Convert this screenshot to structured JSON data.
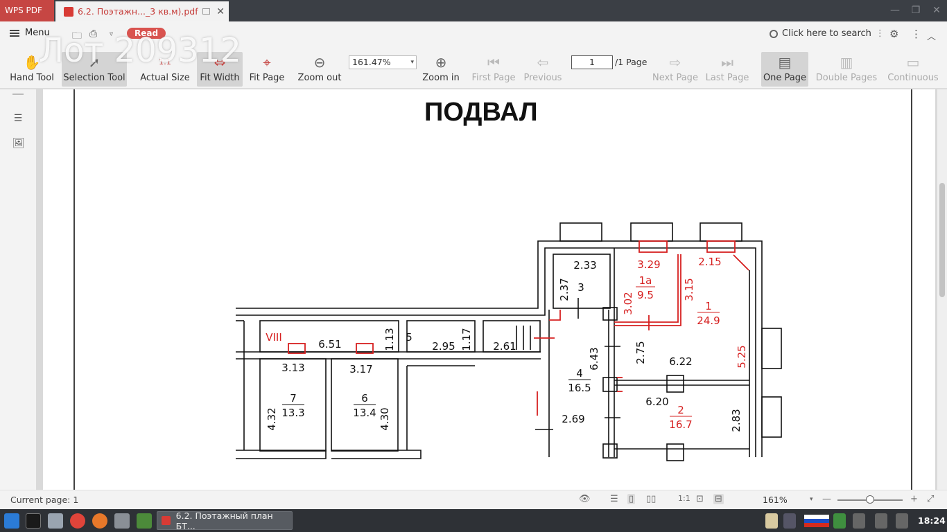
{
  "titlebar": {
    "app_name": "WPS PDF",
    "tab_title": "6.2. Поэтажн..._3 кв.м).pdf",
    "close_glyph": "✕"
  },
  "menubar": {
    "menu_label": "Menu",
    "read_badge": "Read",
    "watermark": "Лот 209312",
    "search_placeholder": "Click here to search"
  },
  "toolbar": {
    "hand_tool": "Hand Tool",
    "selection_tool": "Selection Tool",
    "actual_size": "Actual Size",
    "fit_width": "Fit Width",
    "fit_page": "Fit Page",
    "zoom_out": "Zoom out",
    "zoom_value": "161.47%",
    "zoom_in": "Zoom in",
    "first_page": "First Page",
    "previous": "Previous",
    "page_input": "1",
    "page_total": "/1 Page",
    "next_page": "Next Page",
    "last_page": "Last Page",
    "one_page": "One Page",
    "double_pages": "Double Pages",
    "continuous": "Continuous"
  },
  "document": {
    "title": "ПОДВАЛ",
    "labels": {
      "r2_33": "2.33",
      "r3_29": "3.29",
      "r2_15": "2.15",
      "r2_37": "2.37",
      "r3": "3",
      "r1a": "1a",
      "r9_5": "9.5",
      "r3_15": "3.15",
      "r3_02": "3.02",
      "r1": "1",
      "r24_9": "24.9",
      "rVIII": "VIII",
      "r6_51": "6.51",
      "r1_13": "1.13",
      "r5": "5",
      "r2_95": "2.95",
      "r1_17": "1.17",
      "r2_61": "2.61",
      "r6_43": "6.43",
      "r2_75": "2.75",
      "r6_22": "6.22",
      "r5_25": "5.25",
      "r3_13": "3.13",
      "r3_17": "3.17",
      "r4": "4",
      "r16_5": "16.5",
      "r7": "7",
      "r13_3": "13.3",
      "r6": "6",
      "r13_4": "13.4",
      "r4_32": "4.32",
      "r4_30": "4.30",
      "r6_20": "6.20",
      "r2": "2",
      "r16_7": "16.7",
      "r2_83": "2.83",
      "r2_69": "2.69"
    }
  },
  "statusbar": {
    "current_page": "Current page: 1",
    "zoom": "161%"
  },
  "taskbar": {
    "window_title": "6.2. Поэтажный план БТ...",
    "clock": "18:24"
  },
  "colors": {
    "accent": "#c64643",
    "plan_red": "#d62020",
    "titlebar": "#3b3f45",
    "taskbar": "#2e3136"
  }
}
